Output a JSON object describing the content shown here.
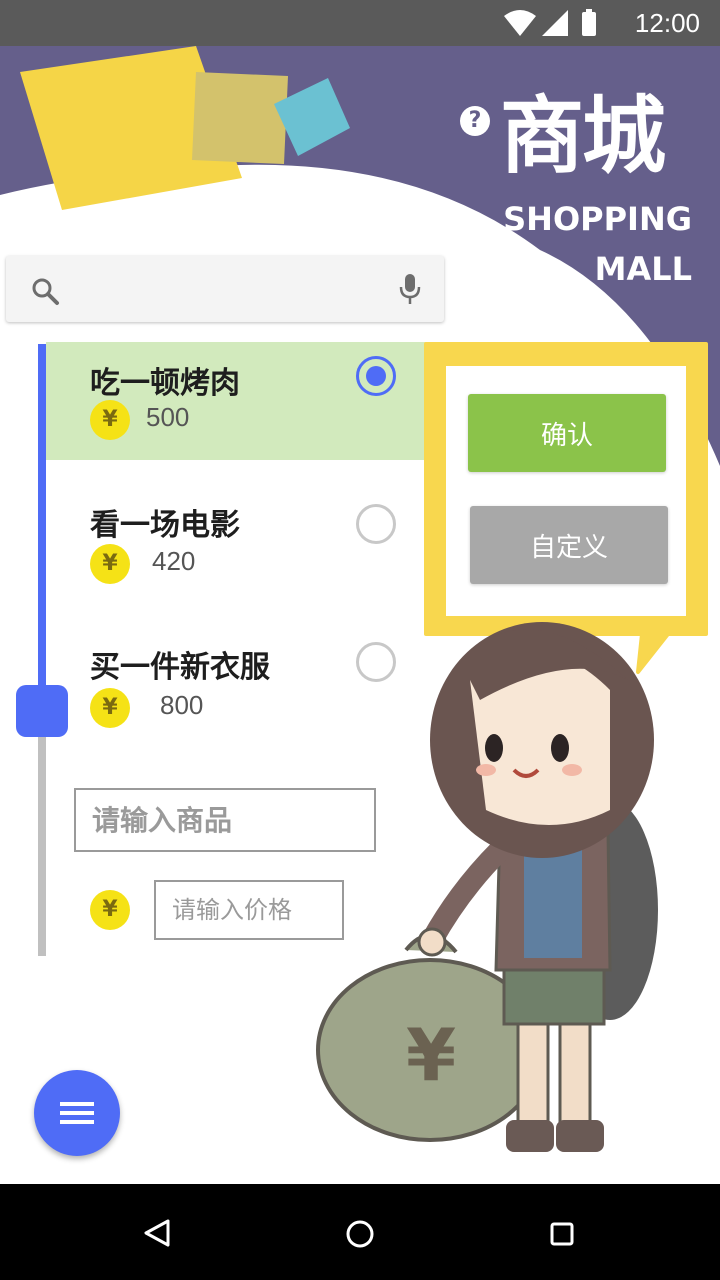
{
  "status_bar": {
    "time": "12:00"
  },
  "header": {
    "title_cn": "商城",
    "title_en_line1": "SHOPPING",
    "title_en_line2": "MALL",
    "help_icon": "help-circle-icon"
  },
  "search": {
    "placeholder": "",
    "search_icon": "search-icon",
    "mic_icon": "mic-icon"
  },
  "items": [
    {
      "name": "吃一顿烤肉",
      "price": "500",
      "currency": "¥",
      "selected": true
    },
    {
      "name": "看一场电影",
      "price": "420",
      "currency": "¥",
      "selected": false
    },
    {
      "name": "买一件新衣服",
      "price": "800",
      "currency": "¥",
      "selected": false
    }
  ],
  "new_item": {
    "product_placeholder": "请输入商品",
    "price_placeholder": "请输入价格",
    "currency": "¥"
  },
  "dialog": {
    "confirm_label": "确认",
    "custom_label": "自定义"
  },
  "fab_icon": "menu-icon",
  "colors": {
    "header_purple": "#655f8b",
    "accent_blue": "#4f6cf6",
    "selected_green": "#d2eabd",
    "confirm_green": "#8bc34a",
    "custom_gray": "#a8a8a8",
    "coin_yellow": "#f5e216",
    "bubble_yellow": "#f8d74e"
  }
}
